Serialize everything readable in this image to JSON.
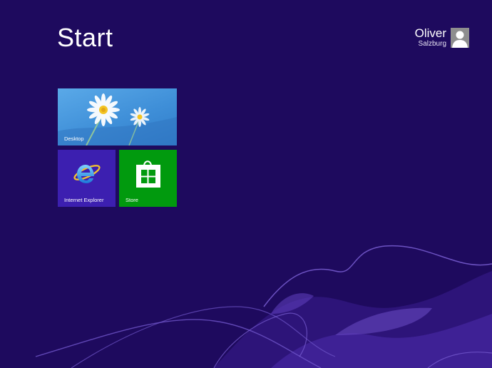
{
  "screen": {
    "title": "Start"
  },
  "user": {
    "name": "Oliver",
    "location": "Salzburg"
  },
  "tiles": [
    {
      "label": "Desktop"
    },
    {
      "label": "Internet Explorer"
    },
    {
      "label": "Store"
    }
  ],
  "colors": {
    "background": "#1e0a5e",
    "ie_tile": "#3c1fb0",
    "store_tile": "#019a0e",
    "desktop_tile": "#3f8fd8"
  }
}
